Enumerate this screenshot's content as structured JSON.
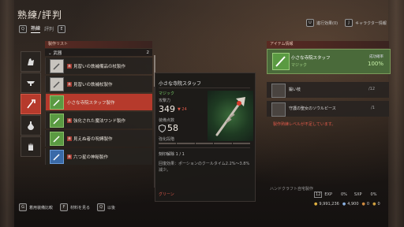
{
  "header": {
    "title": "熟練/評判",
    "tab_key_left": "Q",
    "tab_key_right": "E",
    "tabs": [
      {
        "label": "熟練"
      },
      {
        "label": "評判"
      }
    ]
  },
  "topright": {
    "key1": "U",
    "label1": "進行効果(0)",
    "key2": "J",
    "label2": "キャラクター情報"
  },
  "categories": [
    {
      "icon": "gauntlet-icon"
    },
    {
      "icon": "anvil-icon"
    },
    {
      "icon": "staff-icon"
    },
    {
      "icon": "potion-icon"
    },
    {
      "icon": "glove-icon"
    }
  ],
  "list": {
    "header": "製作リスト",
    "group": "武器",
    "group_count": "2",
    "items": [
      {
        "badge": "未",
        "label": "見習いの鉄補備品の杖製作",
        "icon_color": "gray"
      },
      {
        "badge": "未",
        "label": "見習いの鉄補杖製作",
        "icon_color": "gray"
      },
      {
        "badge": "",
        "label": "小さな寺院スタッフ製作",
        "icon_color": "green",
        "selected": true
      },
      {
        "badge": "未",
        "label": "強化された魔法ワンド製作",
        "icon_color": "green"
      },
      {
        "badge": "未",
        "label": "見えぬ者の呪縛製作",
        "icon_color": "green"
      },
      {
        "badge": "未",
        "label": "六つ星の神秘製作",
        "icon_color": "blue"
      }
    ]
  },
  "detail": {
    "name": "小さな寺院スタッフ",
    "category": "マジック",
    "atk_label": "攻撃力",
    "atk_value": "349",
    "atk_diff": "▼ 24",
    "equip_label": "装備点数",
    "equip_value": "58",
    "stage_label": "強化段階",
    "lock_label": "刻印解除 1 / 1",
    "effect": "回復効果：ポーションのクールタイム2.2%～3.8%減少。",
    "rarity": "グリーン"
  },
  "item_info": {
    "header": "アイテム情報",
    "name": "小さな寺院スタッフ",
    "grade": "マジック",
    "success_label": "成功確率",
    "success_value": "100%",
    "materials": [
      {
        "name": "鍛い枝",
        "count": "/12"
      },
      {
        "name": "守護の聖女のソウルピース",
        "count": "/1"
      }
    ],
    "warning": "製作熟練レベルが不足しています。",
    "footer": "ハンドクラフト自宅製作"
  },
  "status": {
    "level": "12",
    "exp_label": "EXP",
    "exp_value": "0%",
    "sxp_label": "SXP",
    "sxp_value": "0%",
    "gold": "9,991,236",
    "silver": "4,900",
    "a": "0",
    "b": "0"
  },
  "bottom": {
    "key1": "G",
    "label1": "着用装備比較",
    "key2": "F",
    "label2": "材料を見る",
    "key3": "Q",
    "label3": "以後"
  },
  "colors": {
    "accent": "#b63a2c",
    "positive": "#7ad06a",
    "negative": "#e05a4a"
  }
}
